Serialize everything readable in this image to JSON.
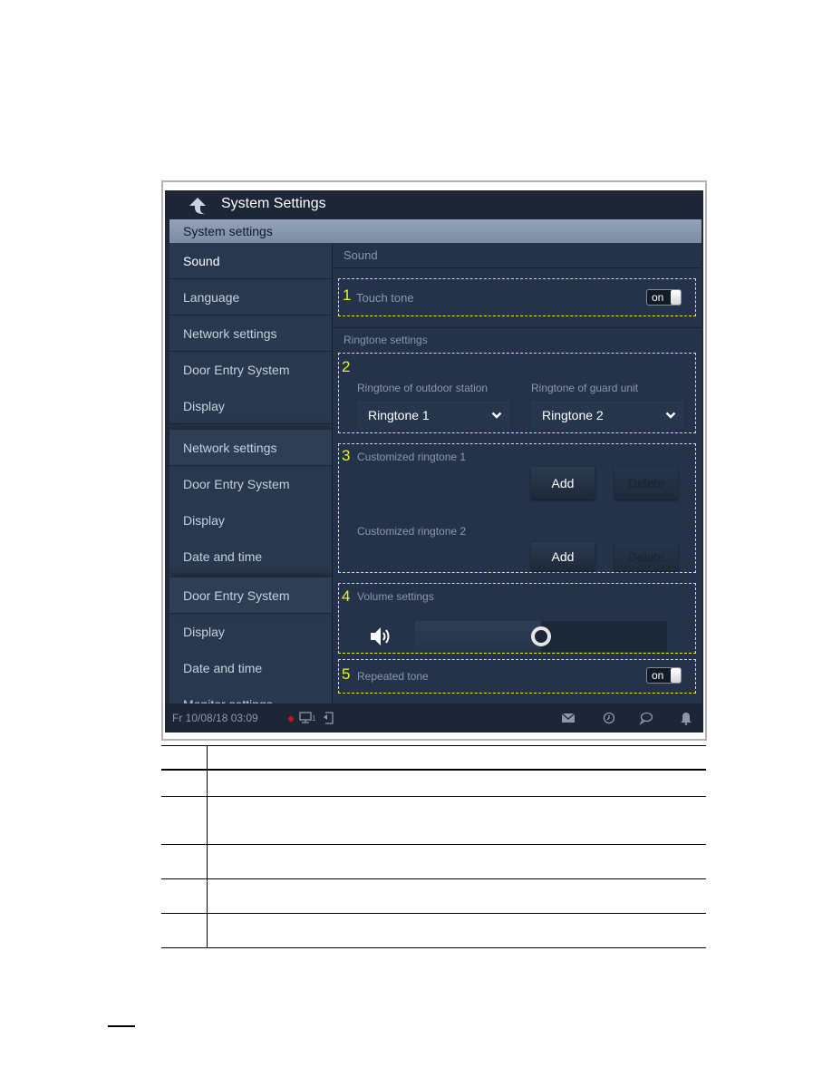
{
  "app": {
    "title": "System Settings",
    "section": "System settings"
  },
  "sidebar": {
    "items": [
      {
        "label": "Sound",
        "active": true
      },
      {
        "label": "Language"
      },
      {
        "label": "Network settings"
      },
      {
        "label": "Door Entry System"
      },
      {
        "label": "Display"
      },
      {
        "label": "Network settings"
      },
      {
        "label": "Door Entry System"
      },
      {
        "label": "Display"
      },
      {
        "label": "Date and time"
      },
      {
        "label": "Door Entry System"
      },
      {
        "label": "Display"
      },
      {
        "label": "Date and time"
      },
      {
        "label": "Monitor settings"
      }
    ]
  },
  "content": {
    "header": "Sound",
    "touch_tone": {
      "marker": "1",
      "label": "Touch tone",
      "toggle": "on"
    },
    "ringtone_settings": {
      "header": "Ringtone settings",
      "marker": "2",
      "outdoor": {
        "label": "Ringtone of outdoor station",
        "value": "Ringtone 1"
      },
      "guard": {
        "label": "Ringtone of guard unit",
        "value": "Ringtone 2"
      }
    },
    "customized": {
      "marker": "3",
      "ringtone1": {
        "label": "Customized ringtone 1",
        "add": "Add",
        "delete": "Delete"
      },
      "ringtone2": {
        "label": "Customized ringtone 2",
        "add": "Add",
        "delete": "Delete"
      }
    },
    "volume": {
      "marker": "4",
      "label": "Volume settings",
      "level_percent": 50
    },
    "repeated_tone": {
      "marker": "5",
      "label": "Repeated tone",
      "toggle": "on"
    }
  },
  "statusbar": {
    "datetime": "Fr 10/08/18  03:09",
    "monitor_count": "1",
    "icons": [
      "record-dot-icon",
      "monitor-icon",
      "exit-icon",
      "mail-icon",
      "history-icon",
      "message-icon",
      "bell-icon"
    ]
  },
  "colors": {
    "highlight": "#e8f22a",
    "background": "#1e2a3c",
    "record_dot": "#d0131a"
  },
  "table": {
    "rows": 6
  }
}
